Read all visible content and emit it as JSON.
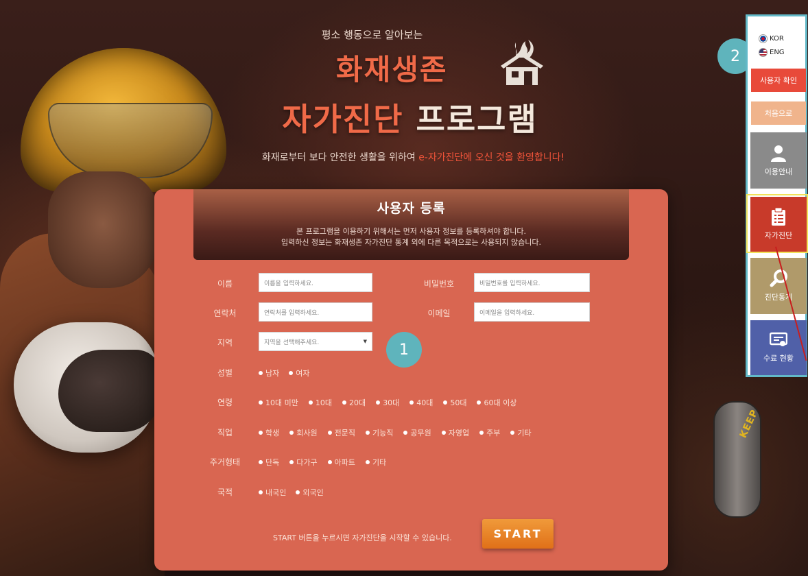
{
  "header": {
    "subtitle": "평소 행동으로 알아보는",
    "title_line1": "화재생존",
    "title_line2_a": "자가진단",
    "title_line2_b": " 프로그램",
    "welcome_prefix": "화재로부터 보다 안전한 생활을 위하여 ",
    "welcome_highlight": "e-자가진단에 오신 것을 환영합니다!"
  },
  "tank_label": "KEEP",
  "form": {
    "title": "사용자 등록",
    "desc_line1": "본 프로그램을 이용하기 위해서는 먼저 사용자 정보를 등록하셔야 합니다.",
    "desc_line2": "입력하신 정보는 화재생존 자가진단 통계 외에 다른 목적으로는 사용되지 않습니다.",
    "name_label": "이름",
    "name_placeholder": "이름을 입력하세요.",
    "password_label": "비밀번호",
    "password_placeholder": "비밀번호를 입력하세요.",
    "contact_label": "연락처",
    "contact_placeholder": "연락처를 입력하세요.",
    "email_label": "이메일",
    "email_placeholder": "이메일을 입력하세요.",
    "region_label": "지역",
    "region_placeholder": "지역을 선택해주세요.",
    "gender_label": "성별",
    "gender_options": [
      "남자",
      "여자"
    ],
    "age_label": "연령",
    "age_options": [
      "10대 미만",
      "10대",
      "20대",
      "30대",
      "40대",
      "50대",
      "60대 이상"
    ],
    "job_label": "직업",
    "job_options": [
      "학생",
      "회사원",
      "전문직",
      "기능직",
      "공무원",
      "자영업",
      "주부",
      "기타"
    ],
    "housing_label": "주거형태",
    "housing_options": [
      "단독",
      "다가구",
      "아파트",
      "기타"
    ],
    "nationality_label": "국적",
    "nationality_options": [
      "내국인",
      "외국인"
    ],
    "start_hint": "START 버튼을 누르시면 자가진단을 시작할 수 있습니다.",
    "start_button": "START"
  },
  "markers": {
    "one": "1",
    "two": "2"
  },
  "sidebar": {
    "lang_kor": "KOR",
    "lang_eng": "ENG",
    "user_check": "사용자 확인",
    "go_home": "처음으로",
    "guide": "이용안내",
    "self_check": "자가진단",
    "stats": "진단통계",
    "completion": "수료 현황"
  },
  "colors": {
    "accent_orange": "#f06a48",
    "panel": "#d96651",
    "marker": "#5fb4bc",
    "sidebar_border": "#62b9c8"
  }
}
